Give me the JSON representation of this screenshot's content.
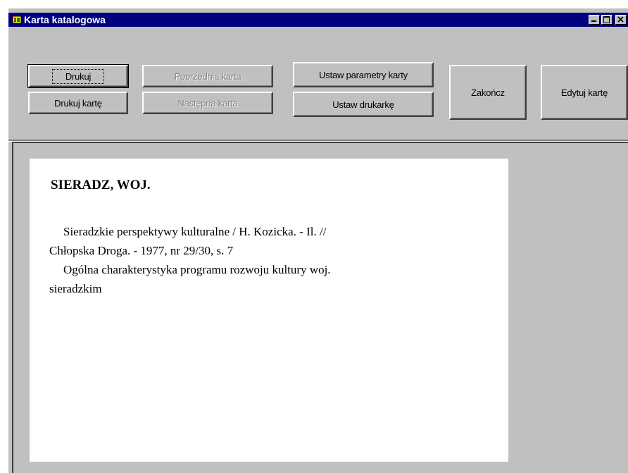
{
  "window": {
    "title": "Karta katalogowa",
    "controls": {
      "minimize": "_",
      "maximize": "□",
      "close": "×"
    }
  },
  "toolbar": {
    "print": "Drukuj",
    "print_card": "Drukuj kartę",
    "previous_card": "Poprzednia karta",
    "next_card": "Następna karta",
    "card_settings": "Ustaw parametry karty",
    "printer_settings": "Ustaw drukarkę",
    "finish": "Zakończ",
    "edit_card": "Edytuj kartę"
  },
  "card": {
    "heading": "SIERADZ, WOJ.",
    "lines": [
      "Sieradzkie perspektywy kulturalne / H. Kozicka. - Il. //",
      "Chłopska Droga. - 1977, nr 29/30, s. 7",
      "Ogólna charakterystyka programu rozwoju kultury woj.",
      "sieradzkim"
    ]
  },
  "colors": {
    "titlebar": "#000080",
    "face": "#c0c0c0",
    "disabled_text": "#808080"
  }
}
